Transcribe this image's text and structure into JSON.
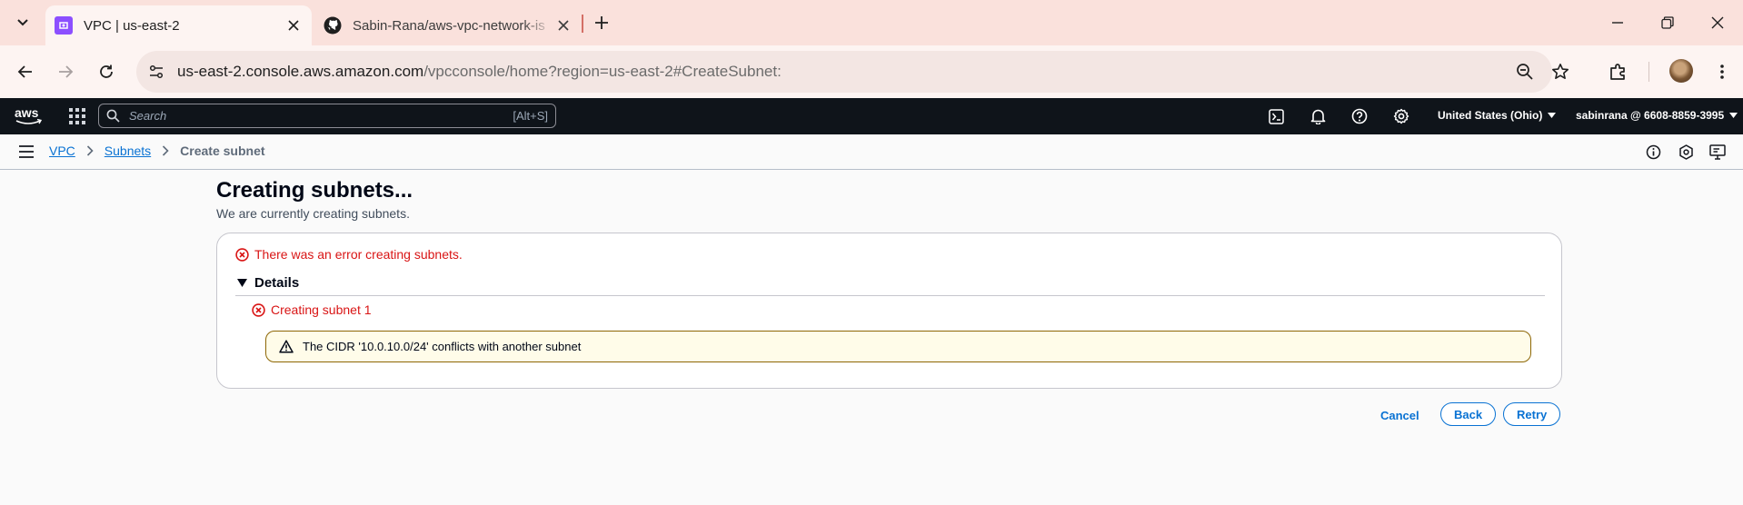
{
  "browser": {
    "tabs": [
      {
        "title": "VPC | us-east-2",
        "active": true
      },
      {
        "title": "Sabin-Rana/aws-vpc-network-is",
        "active": false
      }
    ],
    "url_host": "us-east-2.console.aws.amazon.com",
    "url_path": "/vpcconsole/home?region=us-east-2#CreateSubnet:"
  },
  "aws_nav": {
    "search_placeholder": "Search",
    "search_shortcut": "[Alt+S]",
    "region": "United States (Ohio)",
    "account": "sabinrana @ 6608-8859-3995"
  },
  "breadcrumb": {
    "items": [
      "VPC",
      "Subnets"
    ],
    "current": "Create subnet"
  },
  "main": {
    "title": "Creating subnets...",
    "description": "We are currently creating subnets.",
    "error_message": "There was an error creating subnets.",
    "details_label": "Details",
    "subnet_status": "Creating subnet 1",
    "warning_message": "The CIDR '10.0.10.0/24' conflicts with another subnet"
  },
  "actions": {
    "cancel": "Cancel",
    "back": "Back",
    "retry": "Retry"
  },
  "colors": {
    "aws_nav_bg": "#0f141a",
    "link_blue": "#0972d3",
    "error_red": "#d91515",
    "warning_border": "#8d6605",
    "tabstrip_bg": "#fae1dc"
  },
  "icons": [
    "tab-search-icon",
    "vpc-favicon-icon",
    "github-icon",
    "close-icon",
    "plus-icon",
    "minimize-icon",
    "restore-icon",
    "window-close-icon",
    "back-arrow-icon",
    "forward-arrow-icon",
    "reload-icon",
    "site-settings-icon",
    "zoom-out-icon",
    "star-icon",
    "extensions-icon",
    "more-vert-icon",
    "grid-icon",
    "search-icon",
    "cloudshell-icon",
    "bell-icon",
    "help-icon",
    "gear-icon",
    "hamburger-icon",
    "info-icon",
    "security-icon",
    "feedback-icon",
    "error-icon",
    "warning-icon"
  ]
}
